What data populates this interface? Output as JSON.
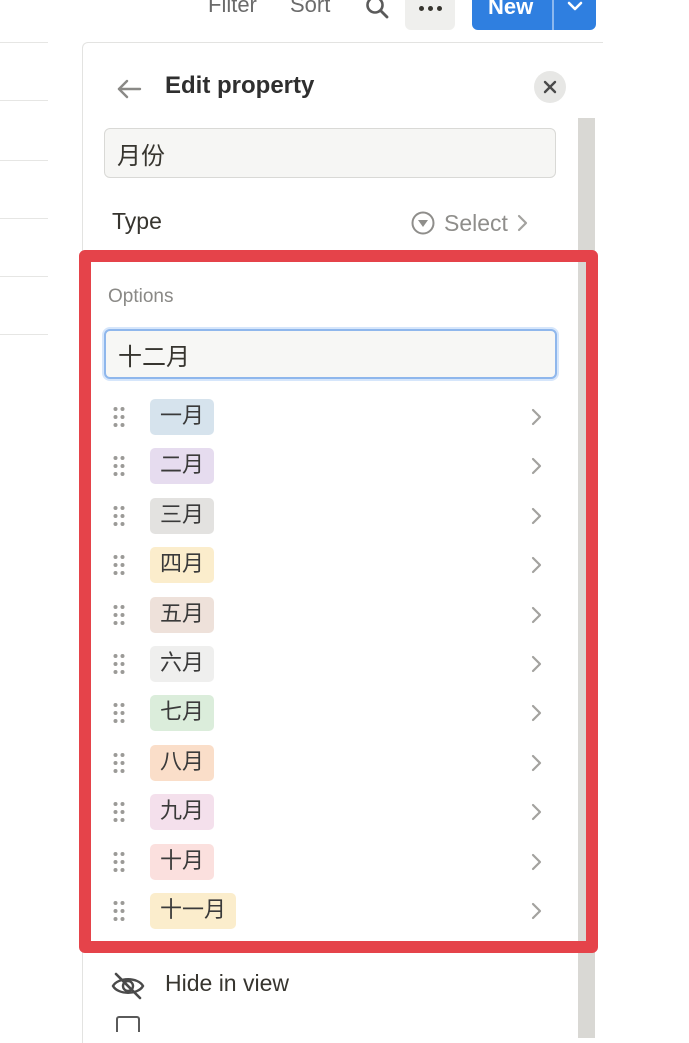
{
  "toolbar": {
    "filter_label": "Filter",
    "sort_label": "Sort",
    "new_label": "New"
  },
  "panel": {
    "title": "Edit property",
    "property_name": "月份",
    "type_label": "Type",
    "type_value": "Select",
    "options_label": "Options",
    "option_input_value": "十二月",
    "hide_label": "Hide in view"
  },
  "options": [
    {
      "label": "一月",
      "bg": "#d6e3ed"
    },
    {
      "label": "二月",
      "bg": "#e6dcef"
    },
    {
      "label": "三月",
      "bg": "#e3e2e0"
    },
    {
      "label": "四月",
      "bg": "#fbedcc"
    },
    {
      "label": "五月",
      "bg": "#eee1da"
    },
    {
      "label": "六月",
      "bg": "#efefee"
    },
    {
      "label": "七月",
      "bg": "#dbeddb"
    },
    {
      "label": "八月",
      "bg": "#fadec9"
    },
    {
      "label": "九月",
      "bg": "#f4e0ec"
    },
    {
      "label": "十月",
      "bg": "#fbe0de"
    },
    {
      "label": "十一月",
      "bg": "#fbedcc"
    }
  ],
  "colors": {
    "accent_blue": "#2f7fe0",
    "highlight_red": "#e5434a"
  }
}
